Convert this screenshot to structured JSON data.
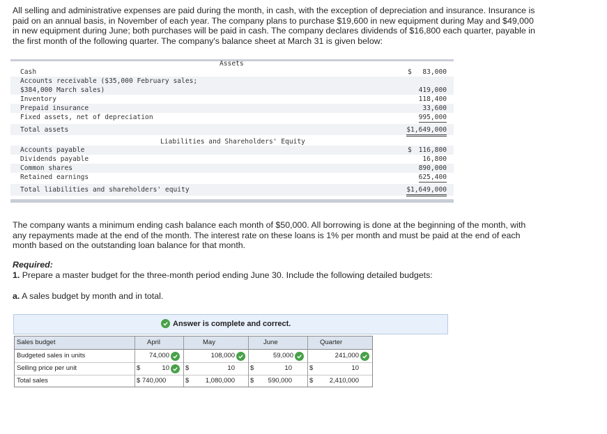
{
  "intro_paragraph": "All selling and administrative expenses are paid during the month, in cash, with the exception of depreciation and insurance. Insurance is paid on an annual basis, in November of each year. The company plans to purchase $19,600 in new equipment during May and $49,000 in new equipment during June; both purchases will be paid in cash. The company declares dividends of $16,800 each quarter, payable in the first month of the following quarter. The company's balance sheet at March 31 is given below:",
  "balance_sheet": {
    "assets_heading": "Assets",
    "cash_label": "Cash",
    "cash_dollar": "$",
    "cash_amount": "83,000",
    "ar_label_line1": "Accounts receivable ($35,000 February sales;",
    "ar_label_line2": "$384,000 March sales)",
    "ar_amount": "419,000",
    "inventory_label": "Inventory",
    "inventory_amount": "118,400",
    "prepaid_label": "Prepaid insurance",
    "prepaid_amount": "33,600",
    "fixed_label": "Fixed assets, net of depreciation",
    "fixed_amount": "995,000",
    "total_assets_label": "Total assets",
    "total_assets_amount": "$1,649,000",
    "liab_heading": "Liabilities and Shareholders' Equity",
    "ap_label": "Accounts payable",
    "ap_dollar": "$",
    "ap_amount": "116,800",
    "div_label": "Dividends payable",
    "div_amount": "16,800",
    "common_label": "Common shares",
    "common_amount": "890,000",
    "retained_label": "Retained earnings",
    "retained_amount": "625,400",
    "total_liab_label": "Total liabilities and shareholders' equity",
    "total_liab_amount": "$1,649,000"
  },
  "cash_paragraph": "The company wants a minimum ending cash balance each month of $50,000. All borrowing is done at the beginning of the month, with any repayments made at the end of the month. The interest rate on these loans is 1% per month and must be paid at the end of each month based on the outstanding loan balance for that month.",
  "required": {
    "title": "Required:",
    "number": "1.",
    "text": "Prepare a master budget for the three-month period ending June 30. Include the following detailed budgets:",
    "sub_letter": "a.",
    "sub_text": "A sales budget by month and in total."
  },
  "banner": {
    "text": "Answer is complete and correct."
  },
  "sales_table": {
    "headers": {
      "label": "Sales budget",
      "april": "April",
      "may": "May",
      "june": "June",
      "quarter": "Quarter"
    },
    "units_label": "Budgeted sales in units",
    "units": {
      "april": "74,000",
      "may": "108,000",
      "june": "59,000",
      "quarter": "241,000"
    },
    "price_label": "Selling price per unit",
    "price_dollar": "$",
    "price": {
      "april": "10",
      "may": "10",
      "june": "10",
      "quarter": "10"
    },
    "total_label": "Total sales",
    "total_dollar": "$",
    "total": {
      "april": "740,000",
      "may": "1,080,000",
      "june": "590,000",
      "quarter": "2,410,000"
    }
  },
  "colors": {
    "check_green": "#48a148",
    "banner_bg": "#e8f0fb",
    "header_bg": "#dbe3ee",
    "row_shade": "#f0f2f5"
  }
}
